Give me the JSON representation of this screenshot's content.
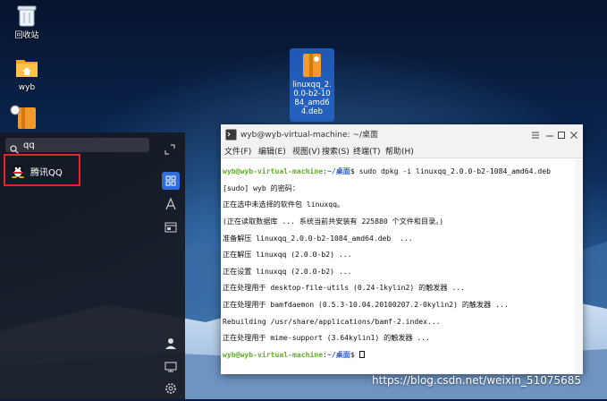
{
  "desktop": {
    "icons": [
      {
        "label": "回收站",
        "icon": "trash-icon"
      },
      {
        "label": "wyb",
        "icon": "home-folder-icon"
      },
      {
        "label": "linuxqq_2.0.0-b2-1084_amd64.deb",
        "icon": "deb-package-icon"
      }
    ]
  },
  "launcher": {
    "search_value": "qq",
    "result": {
      "label": "腾讯QQ",
      "icon": "qq-penguin-icon"
    },
    "side_icons": [
      "expand-icon",
      "all-apps-icon",
      "text-icon",
      "window-icon",
      "user-icon",
      "monitor-icon",
      "settings-icon"
    ],
    "accent": "#2e6fdd",
    "highlight_border": "#e8242b"
  },
  "terminal": {
    "title": "wyb@wyb-virtual-machine: ~/桌面",
    "menu": [
      "文件(F)",
      "编辑(E)",
      "视图(V)",
      "搜索(S)",
      "终端(T)",
      "帮助(H)"
    ],
    "lines": [
      {
        "user": "wyb@wyb-virtual-machine",
        "path": "~/桌面",
        "cmd": "$ sudo dpkg -i linuxqq_2.0.0-b2-1084_amd64.deb"
      },
      {
        "text": "[sudo] wyb 的密码："
      },
      {
        "text": "正在选中未选择的软件包 linuxqq。"
      },
      {
        "text": "(正在读取数据库 ... 系统当前共安装有 225880 个文件和目录。)"
      },
      {
        "text": "准备解压 linuxqq_2.0.0-b2-1084_amd64.deb  ..."
      },
      {
        "text": "正在解压 linuxqq (2.0.0-b2) ..."
      },
      {
        "text": "正在设置 linuxqq (2.0.0-b2) ..."
      },
      {
        "text": "正在处理用于 desktop-file-utils (0.24-1kylin2) 的触发器 ..."
      },
      {
        "text": "正在处理用于 bamfdaemon (0.5.3-10.04.20100207.2-0kylin2) 的触发器 ..."
      },
      {
        "text": "Rebuilding /usr/share/applications/bamf-2.index..."
      },
      {
        "text": "正在处理用于 mime-support (3.64kylin1) 的触发器 ..."
      },
      {
        "user": "wyb@wyb-virtual-machine",
        "path": "~/桌面",
        "cmd": "$ "
      }
    ],
    "colors": {
      "user": "#5fae1f",
      "path": "#3560c8"
    }
  },
  "watermark": "https://blog.csdn.net/weixin_51075685"
}
